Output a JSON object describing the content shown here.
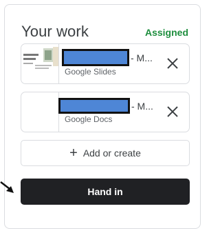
{
  "card": {
    "title": "Your work",
    "status": "Assigned"
  },
  "attachments": [
    {
      "name_suffix": "- M...",
      "type": "Google Slides",
      "thumbnail": "slides-thumbnail",
      "remove_icon": "close-icon"
    },
    {
      "name_suffix": "- M...",
      "type": "Google Docs",
      "thumbnail": "docs-thumbnail",
      "remove_icon": "close-icon"
    }
  ],
  "add_button": {
    "label": "Add or create",
    "icon": "plus-icon"
  },
  "hand_in_button": {
    "label": "Hand in"
  },
  "annotation": {
    "icon": "arrow-pointer-icon"
  },
  "colors": {
    "status_green": "#1e8e3e",
    "hand_in_bg": "#202124",
    "redaction_fill": "#4e86d6",
    "border": "#dadce0"
  }
}
